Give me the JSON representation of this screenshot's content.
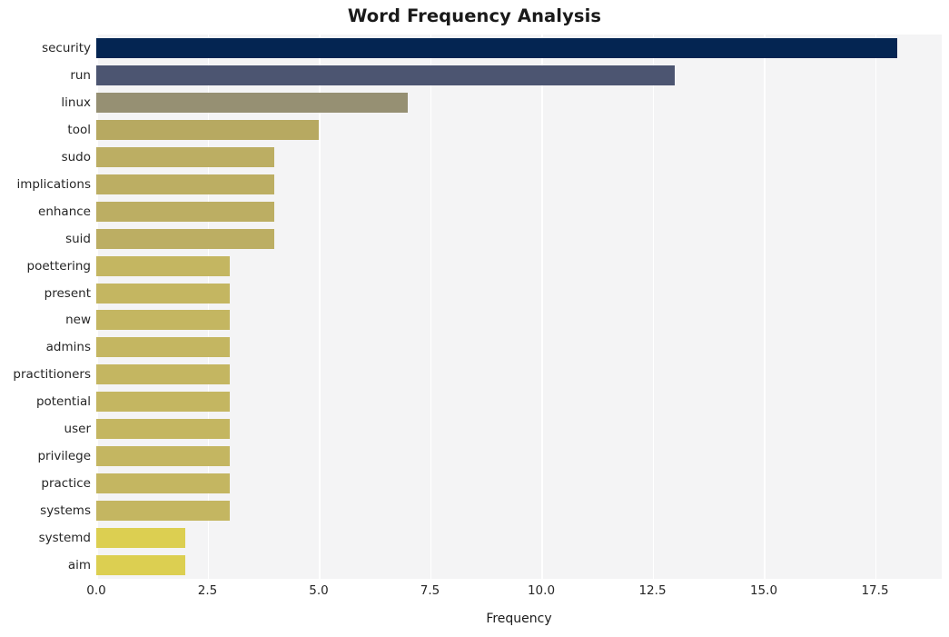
{
  "chart_data": {
    "type": "bar",
    "orientation": "horizontal",
    "title": "Word Frequency Analysis",
    "xlabel": "Frequency",
    "ylabel": "",
    "categories": [
      "security",
      "run",
      "linux",
      "tool",
      "sudo",
      "implications",
      "enhance",
      "suid",
      "poettering",
      "present",
      "new",
      "admins",
      "practitioners",
      "potential",
      "user",
      "privilege",
      "practice",
      "systems",
      "systemd",
      "aim"
    ],
    "values": [
      18,
      13,
      7,
      5,
      4,
      4,
      4,
      4,
      3,
      3,
      3,
      3,
      3,
      3,
      3,
      3,
      3,
      3,
      2,
      2
    ],
    "bar_colors": [
      "#042552",
      "#4c5571",
      "#969073",
      "#b7a961",
      "#bcae63",
      "#bcae63",
      "#bcae63",
      "#bcae63",
      "#c4b661",
      "#c4b661",
      "#c4b661",
      "#c4b661",
      "#c4b661",
      "#c4b661",
      "#c4b661",
      "#c4b661",
      "#c4b661",
      "#c4b661",
      "#dccf51",
      "#dccf51"
    ],
    "xlim": [
      0.0,
      19.0
    ],
    "xticks": [
      0.0,
      2.5,
      5.0,
      7.5,
      10.0,
      12.5,
      15.0,
      17.5
    ],
    "xtick_labels": [
      "0.0",
      "2.5",
      "5.0",
      "7.5",
      "10.0",
      "12.5",
      "15.0",
      "17.5"
    ],
    "grid": true,
    "grid_axis": "x",
    "grid_color": "#ffffff",
    "plot_background": "#f4f4f5",
    "figure_background": "#ffffff",
    "legend": null
  }
}
